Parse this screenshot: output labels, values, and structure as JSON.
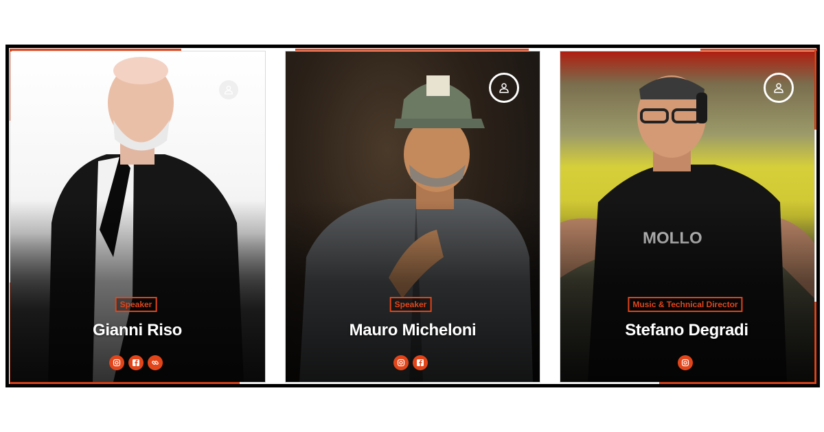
{
  "colors": {
    "accent": "#e2451a",
    "frame": "#000000",
    "text": "#ffffff"
  },
  "cards": [
    {
      "role": "Speaker",
      "name": "Gianni Riso",
      "socials": [
        "instagram-icon",
        "facebook-icon",
        "link-icon"
      ]
    },
    {
      "role": "Speaker",
      "name": "Mauro Micheloni",
      "socials": [
        "instagram-icon",
        "facebook-icon"
      ]
    },
    {
      "role": "Music & Technical Director",
      "name": "Stefano Degradi",
      "socials": [
        "instagram-icon"
      ]
    }
  ]
}
